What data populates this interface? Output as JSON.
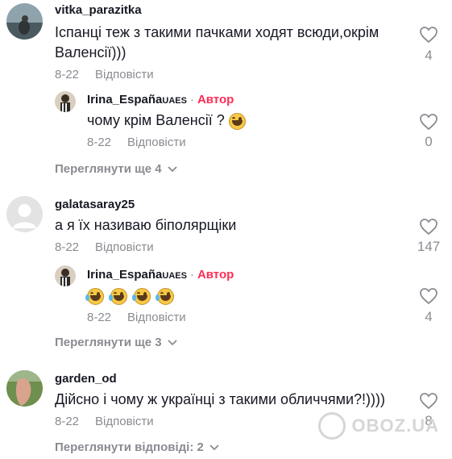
{
  "comments": [
    {
      "username": "vitka_parazitka",
      "text_line1": "Іспанці теж з такими пачками ходят всюди,окрім",
      "text_line2": "Валенсії)))",
      "date": "8-22",
      "reply_label": "Відповісти",
      "likes": "4",
      "reply": {
        "username": "Irina_España",
        "flag": "UAES",
        "author_label": "Автор",
        "text": "чому крім Валенсії ?",
        "date": "8-22",
        "reply_label": "Відповісти",
        "likes": "0"
      },
      "view_more": "Переглянути ще 4"
    },
    {
      "username": "galatasaray25",
      "text_line1": "а я їх називаю біполярщіки",
      "date": "8-22",
      "reply_label": "Відповісти",
      "likes": "147",
      "reply": {
        "username": "Irina_España",
        "flag": "UAES",
        "author_label": "Автор",
        "date": "8-22",
        "reply_label": "Відповісти",
        "likes": "4"
      },
      "view_more": "Переглянути ще 3"
    },
    {
      "username": "garden_od",
      "text_line1": "Дійсно і чому ж українці з такими обличчями?!))))",
      "date": "8-22",
      "reply_label": "Відповісти",
      "likes": "8",
      "view_more": "Переглянути відповіді: 2"
    }
  ],
  "watermark": "OBOZ.UA",
  "icons": {
    "like": "heart-outline-icon",
    "expand": "chevron-down-icon"
  },
  "colors": {
    "author": "#fe2c55",
    "secondary": "#8a8b91",
    "text": "#161823"
  }
}
